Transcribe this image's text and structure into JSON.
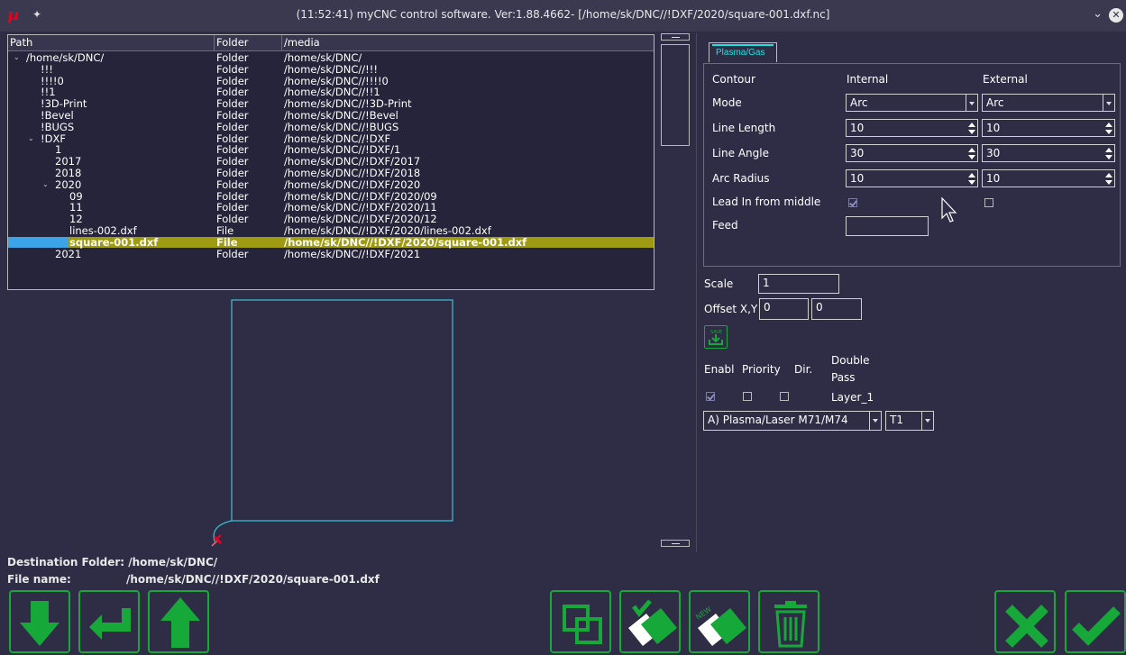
{
  "window": {
    "title": "(11:52:41) myCNC control software. Ver:1.88.4662- [/home/sk/DNC//!DXF/2020/square-001.dxf.nc]",
    "logo": "μ",
    "pin_icon": "pin-icon",
    "collapse_icon": "chevron-down-icon",
    "close_icon": "close-icon"
  },
  "tree": {
    "headers": [
      "Path",
      "Folder",
      "/media"
    ],
    "rows": [
      {
        "name": "/home/sk/DNC/",
        "type": "Folder",
        "path": "/home/sk/DNC/",
        "expanded": true
      },
      {
        "name": "!!!",
        "type": "Folder",
        "path": "/home/sk/DNC//!!!"
      },
      {
        "name": "!!!!0",
        "type": "Folder",
        "path": "/home/sk/DNC//!!!!0"
      },
      {
        "name": "!!1",
        "type": "Folder",
        "path": "/home/sk/DNC//!!1"
      },
      {
        "name": "!3D-Print",
        "type": "Folder",
        "path": "/home/sk/DNC//!3D-Print"
      },
      {
        "name": "!Bevel",
        "type": "Folder",
        "path": "/home/sk/DNC//!Bevel"
      },
      {
        "name": "!BUGS",
        "type": "Folder",
        "path": "/home/sk/DNC//!BUGS"
      },
      {
        "name": "!DXF",
        "type": "Folder",
        "path": "/home/sk/DNC//!DXF",
        "expanded": true
      },
      {
        "name": "1",
        "type": "Folder",
        "path": "/home/sk/DNC//!DXF/1"
      },
      {
        "name": "2017",
        "type": "Folder",
        "path": "/home/sk/DNC//!DXF/2017"
      },
      {
        "name": "2018",
        "type": "Folder",
        "path": "/home/sk/DNC//!DXF/2018"
      },
      {
        "name": "2020",
        "type": "Folder",
        "path": "/home/sk/DNC//!DXF/2020",
        "expanded": true
      },
      {
        "name": "09",
        "type": "Folder",
        "path": "/home/sk/DNC//!DXF/2020/09"
      },
      {
        "name": "11",
        "type": "Folder",
        "path": "/home/sk/DNC//!DXF/2020/11"
      },
      {
        "name": "12",
        "type": "Folder",
        "path": "/home/sk/DNC//!DXF/2020/12"
      },
      {
        "name": "lines-002.dxf",
        "type": "File",
        "path": "/home/sk/DNC//!DXF/2020/lines-002.dxf"
      },
      {
        "name": "square-001.dxf",
        "type": "File",
        "path": "/home/sk/DNC//!DXF/2020/square-001.dxf",
        "selected": true
      },
      {
        "name": "2021",
        "type": "Folder",
        "path": "/home/sk/DNC//!DXF/2021"
      }
    ]
  },
  "footer": {
    "destination_label": "Destination Folder: /home/sk/DNC/",
    "file_name_label": "File name:",
    "file_name_value": "/home/sk/DNC//!DXF/2020/square-001.dxf"
  },
  "bottom_buttons": [
    {
      "name": "scroll-down-button",
      "icon": "arrow-down-icon"
    },
    {
      "name": "enter-button",
      "icon": "enter-arrow-icon"
    },
    {
      "name": "scroll-up-button",
      "icon": "arrow-up-icon"
    },
    {
      "name": "copy-button",
      "icon": "copy-icon"
    },
    {
      "name": "apply-button",
      "icon": "check-files-icon"
    },
    {
      "name": "new-button",
      "icon": "new-files-icon"
    },
    {
      "name": "delete-button",
      "icon": "trash-icon"
    },
    {
      "name": "cancel-button",
      "icon": "x-icon"
    },
    {
      "name": "ok-button",
      "icon": "check-icon"
    }
  ],
  "plasma": {
    "tab_label": "Plasma/Gas",
    "contour_label": "Contour",
    "internal_label": "Internal",
    "external_label": "External",
    "mode_label": "Mode",
    "mode_internal": "Arc",
    "mode_external": "Arc",
    "line_length_label": "Line Length",
    "line_length_internal": "10",
    "line_length_external": "10",
    "line_angle_label": "Line Angle",
    "line_angle_internal": "30",
    "line_angle_external": "30",
    "arc_radius_label": "Arc Radius",
    "arc_radius_internal": "10",
    "arc_radius_external": "10",
    "lead_in_label": "Lead In from middle",
    "lead_in_internal": true,
    "lead_in_external": false,
    "feed_label": "Feed",
    "feed_value": ""
  },
  "transform": {
    "scale_label": "Scale",
    "scale_value": "1",
    "offset_label": "Offset X,Y",
    "offset_x": "0",
    "offset_y": "0",
    "save_label": "SAVE"
  },
  "layers": {
    "headers": {
      "enable": "Enabl",
      "priority": "Priority",
      "dir": "Dir.",
      "double_pass_1": "Double",
      "double_pass_2": "Pass"
    },
    "rows": [
      {
        "enabled": true,
        "priority": false,
        "dir": false,
        "name": "Layer_1",
        "tool_type": "A) Plasma/Laser M71/M74",
        "tool": "T1"
      }
    ]
  },
  "colors": {
    "accent_green": "#17a83a",
    "selection": "#9e9a12",
    "tab_accent": "#23e0e0",
    "path_preview": "#3ac4d8"
  }
}
